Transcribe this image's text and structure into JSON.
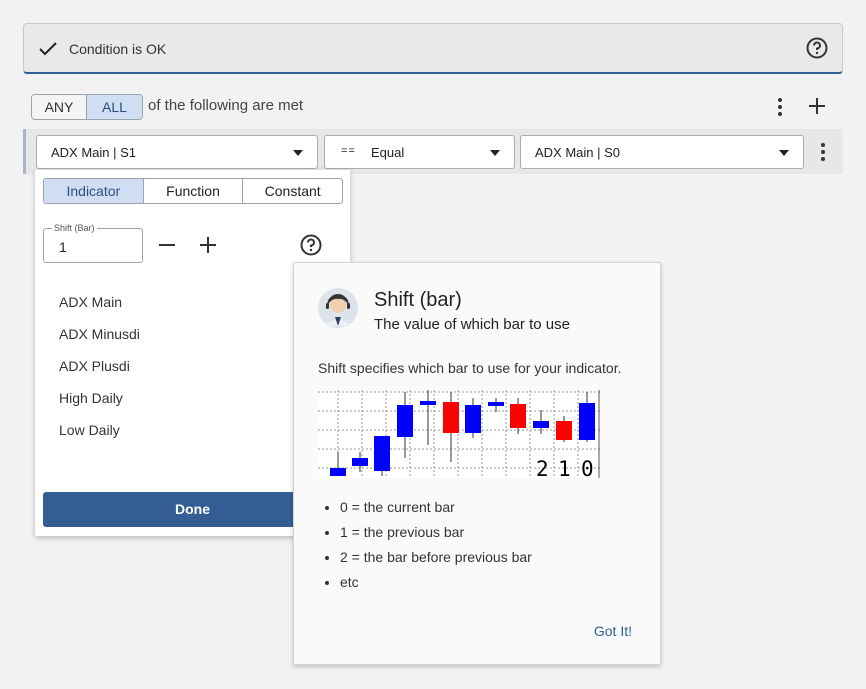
{
  "banner": {
    "text": "Condition is OK"
  },
  "logic": {
    "any_label": "ANY",
    "all_label": "ALL",
    "selected": "ALL",
    "suffix": "of the following are met"
  },
  "condition_row": {
    "left": "ADX Main | S1",
    "operator_symbol": "==",
    "operator_label": "Equal",
    "right": "ADX Main | S0"
  },
  "dropdown": {
    "tabs": [
      "Indicator",
      "Function",
      "Constant"
    ],
    "active_tab": "Indicator",
    "shift_label": "Shift (Bar)",
    "shift_value": "1",
    "items": [
      "ADX Main",
      "ADX Minusdi",
      "ADX Plusdi",
      "High Daily",
      "Low Daily"
    ],
    "done_label": "Done"
  },
  "popup": {
    "title": "Shift (bar)",
    "subtitle": "The value of which bar to use",
    "description": "Shift specifies which bar to use for your indicator.",
    "bar_labels": [
      "2",
      "1",
      "0"
    ],
    "bullets": [
      "0 = the current bar",
      "1 = the previous bar",
      "2 = the bar before previous bar",
      "etc"
    ],
    "ok_label": "Got It!"
  },
  "colors": {
    "accent": "#345e93",
    "bull": "#0000ff",
    "bear": "#ff0000",
    "selected_bg": "#cfdef3"
  }
}
